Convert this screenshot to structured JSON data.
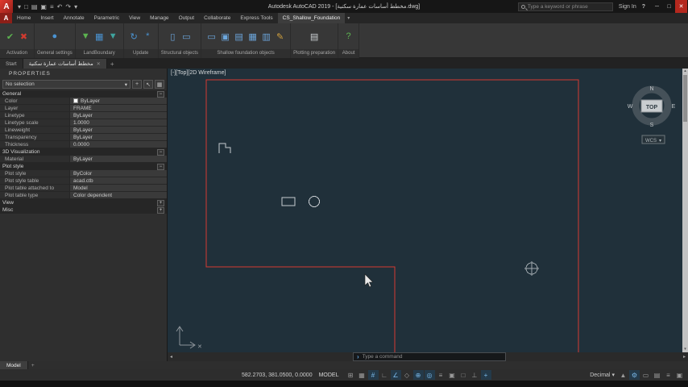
{
  "colors": {
    "accent_red": "#c8332d",
    "canvas_bg": "#20303a",
    "line_red": "#d43a32",
    "shape_gray": "#c6cbd0",
    "enabled_blue": "#7ab8e8"
  },
  "titlebar": {
    "logo_letter": "A",
    "quick_access_icons": [
      {
        "name": "app-dropdown-icon",
        "glyph": "▾"
      },
      {
        "name": "new-file-icon",
        "glyph": "□"
      },
      {
        "name": "open-file-icon",
        "glyph": "▤"
      },
      {
        "name": "save-icon",
        "glyph": "▣"
      },
      {
        "name": "plot-icon",
        "glyph": "≡"
      },
      {
        "name": "undo-icon",
        "glyph": "↶"
      },
      {
        "name": "redo-icon",
        "glyph": "↷"
      },
      {
        "name": "qat-more-icon",
        "glyph": "▾"
      }
    ],
    "title": "Autodesk AutoCAD 2019 - [مخطط أساسات عمارة سكنية.dwg]",
    "search_placeholder": "Type a keyword or phrase",
    "signin_label": "Sign In",
    "help_glyph": "?",
    "window_controls": [
      {
        "name": "minimize-button",
        "glyph": "─"
      },
      {
        "name": "maximize-button",
        "glyph": "□"
      },
      {
        "name": "close-button",
        "glyph": "✕"
      }
    ]
  },
  "ribbon": {
    "tab_overflow_glyph": "▾",
    "tabs": [
      {
        "label": "Home",
        "active": false
      },
      {
        "label": "Insert",
        "active": false
      },
      {
        "label": "Annotate",
        "active": false
      },
      {
        "label": "Parametric",
        "active": false
      },
      {
        "label": "View",
        "active": false
      },
      {
        "label": "Manage",
        "active": false
      },
      {
        "label": "Output",
        "active": false
      },
      {
        "label": "Collaborate",
        "active": false
      },
      {
        "label": "Express Tools",
        "active": false
      },
      {
        "label": "CS_Shallow_Foundation",
        "active": true
      }
    ],
    "panels": [
      {
        "label": "Activation",
        "buttons": [
          {
            "name": "activate-check-button",
            "glyph": "✔",
            "color": "#5cb450"
          },
          {
            "name": "deactivate-button",
            "glyph": "✖",
            "color": "#d03a2f"
          }
        ]
      },
      {
        "label": "General settings",
        "buttons": [
          {
            "name": "general-settings-button",
            "glyph": "●",
            "color": "#4a93d2"
          }
        ]
      },
      {
        "label": "LandBoundary",
        "buttons": [
          {
            "name": "land-filter-button",
            "glyph": "▼",
            "color": "#5cb450"
          },
          {
            "name": "land-table-button",
            "glyph": "▦",
            "color": "#4a93d2"
          },
          {
            "name": "land-pick-button",
            "glyph": "▼",
            "color": "#3fa49e"
          }
        ]
      },
      {
        "label": "Update",
        "buttons": [
          {
            "name": "update-refresh-button",
            "glyph": "↻",
            "color": "#4a93d2"
          },
          {
            "name": "update-regen-button",
            "glyph": "*",
            "color": "#4a93d2"
          }
        ]
      },
      {
        "label": "Structural objects",
        "buttons": [
          {
            "name": "grid-lines-button",
            "glyph": "▯",
            "color": "#6ca6dc"
          },
          {
            "name": "columns-button",
            "glyph": "▭",
            "color": "#6ca6dc"
          }
        ]
      },
      {
        "label": "Shallow foundation objects",
        "buttons": [
          {
            "name": "isolated-footing-button",
            "glyph": "▭",
            "color": "#6ca6dc"
          },
          {
            "name": "combined-footing-button",
            "glyph": "▣",
            "color": "#6ca6dc"
          },
          {
            "name": "strap-footing-button",
            "glyph": "▤",
            "color": "#6ca6dc"
          },
          {
            "name": "raft-foundation-button",
            "glyph": "▦",
            "color": "#6ca6dc"
          },
          {
            "name": "strip-footing-button",
            "glyph": "▥",
            "color": "#6ca6dc"
          },
          {
            "name": "draw-annotation-button",
            "glyph": "✎",
            "color": "#d2a13e"
          }
        ]
      },
      {
        "label": "Plotting preparation",
        "buttons": [
          {
            "name": "plot-frames-button",
            "glyph": "▤",
            "color": "#cdd2d5"
          }
        ]
      },
      {
        "label": "About",
        "buttons": [
          {
            "name": "about-button",
            "glyph": "?",
            "color": "#5cb450"
          }
        ]
      }
    ]
  },
  "file_tabs": {
    "close_glyph": "✕",
    "new_tab_glyph": "+",
    "tabs": [
      {
        "label": "Start",
        "active": false
      },
      {
        "label": "مخطط أساسات عمارة سكنية",
        "active": true
      }
    ]
  },
  "properties": {
    "title": "PROPERTIES",
    "selection_value": "No selection",
    "dropdown_glyph": "▾",
    "toolbar_buttons": [
      {
        "name": "toggle-pickadd-button",
        "glyph": "+"
      },
      {
        "name": "select-objects-button",
        "glyph": "↖"
      },
      {
        "name": "quick-select-button",
        "glyph": "▦"
      }
    ],
    "sections": [
      {
        "label": "General",
        "collapsed": false,
        "rows": [
          {
            "label": "Color",
            "value": "ByLayer",
            "swatch": "#ffffff"
          },
          {
            "label": "Layer",
            "value": "FRAME"
          },
          {
            "label": "Linetype",
            "value": "ByLayer"
          },
          {
            "label": "Linetype scale",
            "value": "1.0000"
          },
          {
            "label": "Lineweight",
            "value": "ByLayer"
          },
          {
            "label": "Transparency",
            "value": "ByLayer"
          },
          {
            "label": "Thickness",
            "value": "0.0000"
          }
        ]
      },
      {
        "label": "3D Visualization",
        "collapsed": false,
        "rows": [
          {
            "label": "Material",
            "value": "ByLayer"
          }
        ]
      },
      {
        "label": "Plot style",
        "collapsed": false,
        "rows": [
          {
            "label": "Plot style",
            "value": "ByColor"
          },
          {
            "label": "Plot style table",
            "value": "acad.ctb"
          },
          {
            "label": "Plot table attached to",
            "value": "Model"
          },
          {
            "label": "Plot table type",
            "value": "Color dependent"
          }
        ]
      },
      {
        "label": "View",
        "collapsed": true,
        "rows": []
      },
      {
        "label": "Misc",
        "collapsed": true,
        "rows": []
      }
    ]
  },
  "viewport": {
    "label": "[-][Top][2D Wireframe]",
    "compass": {
      "north": "N",
      "east": "E",
      "south": "S",
      "west": "W",
      "cube_face": "TOP",
      "ucs_label": "WCS",
      "ucs_dropdown_glyph": "▾"
    },
    "ucs_x_mark": "✕"
  },
  "scrollbar": {
    "up": "▴",
    "down": "▾",
    "left": "◂",
    "right": "▸"
  },
  "command_line": {
    "prompt_glyph": "›",
    "placeholder": "Type a command"
  },
  "layout": {
    "add_glyph": "+",
    "tabs": [
      {
        "label": "Model",
        "active": true
      }
    ]
  },
  "statusbar": {
    "coordinates": "582.2703, 381.0500, 0.0000",
    "model_label": "MODEL",
    "left_icons": [
      {
        "name": "infer-constraints-icon",
        "glyph": "⊞",
        "on": false
      },
      {
        "name": "snap-mode-icon",
        "glyph": "▦",
        "on": false
      },
      {
        "name": "grid-display-icon",
        "glyph": "#",
        "on": true
      },
      {
        "name": "ortho-mode-icon",
        "glyph": "∟",
        "on": false
      },
      {
        "name": "polar-tracking-icon",
        "glyph": "∠",
        "on": true
      },
      {
        "name": "isometric-drafting-icon",
        "glyph": "◇",
        "on": false
      },
      {
        "name": "object-snap-tracking-icon",
        "glyph": "⊕",
        "on": true
      },
      {
        "name": "object-snap-icon",
        "glyph": "◎",
        "on": true
      },
      {
        "name": "lineweight-icon",
        "glyph": "≡",
        "on": false
      },
      {
        "name": "transparency-icon",
        "glyph": "▣",
        "on": false
      },
      {
        "name": "selection-cycling-icon",
        "glyph": "□",
        "on": false
      },
      {
        "name": "dynamic-ucs-icon",
        "glyph": "⊥",
        "on": false
      },
      {
        "name": "dynamic-input-icon",
        "glyph": "+",
        "on": true
      }
    ],
    "units_label": "Decimal",
    "units_dropdown_glyph": "▾",
    "right_icons": [
      {
        "name": "annotation-scale-icon",
        "glyph": "▲",
        "on": false
      },
      {
        "name": "workspace-switching-icon",
        "glyph": "⚙",
        "on": true
      },
      {
        "name": "annotation-monitor-icon",
        "glyph": "▭",
        "on": false
      },
      {
        "name": "quick-properties-icon",
        "glyph": "▤",
        "on": false
      },
      {
        "name": "customization-icon",
        "glyph": "≡",
        "on": false
      },
      {
        "name": "clean-screen-icon",
        "glyph": "▣",
        "on": false
      }
    ]
  }
}
